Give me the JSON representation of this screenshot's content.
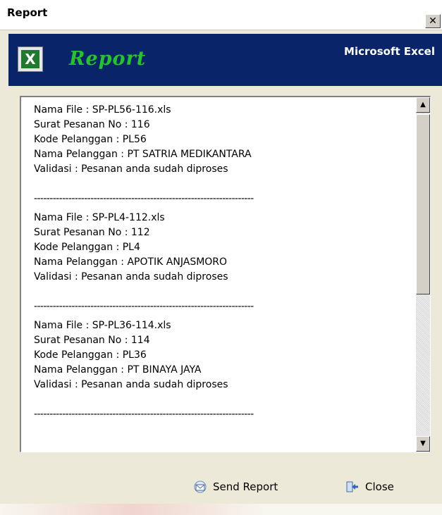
{
  "window": {
    "title": "Report",
    "close_symbol": "✕"
  },
  "banner": {
    "icon": "excel-icon",
    "heading": "Report",
    "product": "Microsoft Excel"
  },
  "report": {
    "separator": "----------------------------------------------------------------------",
    "entries": [
      {
        "file": "Nama File : SP-PL56-116.xls",
        "order_no": "Surat Pesanan No : 116",
        "customer_code": "Kode Pelanggan : PL56",
        "customer_name": "Nama Pelanggan : PT SATRIA MEDIKANTARA",
        "validation": "Validasi : Pesanan anda sudah diproses"
      },
      {
        "file": "Nama File : SP-PL4-112.xls",
        "order_no": "Surat Pesanan No : 112",
        "customer_code": "Kode Pelanggan : PL4",
        "customer_name": "Nama Pelanggan : APOTIK ANJASMORO",
        "validation": "Validasi : Pesanan anda sudah diproses"
      },
      {
        "file": "Nama File : SP-PL36-114.xls",
        "order_no": "Surat Pesanan No : 114",
        "customer_code": "Kode Pelanggan : PL36",
        "customer_name": "Nama Pelanggan : PT BINAYA JAYA",
        "validation": "Validasi : Pesanan anda sudah diproses"
      }
    ]
  },
  "footer": {
    "send_label": "Send Report",
    "close_label": "Close"
  },
  "colors": {
    "banner_bg": "#0a246a",
    "report_green": "#24c52a"
  }
}
